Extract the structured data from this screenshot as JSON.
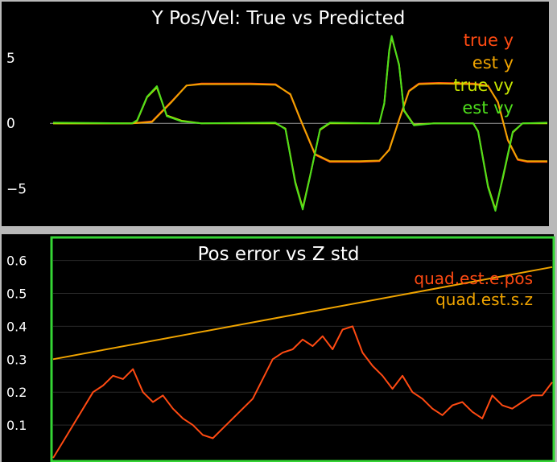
{
  "colors": {
    "true_y": "#ff4a12",
    "est_y": "#f0a400",
    "true_vy": "#c6e400",
    "est_vy": "#4ede1c",
    "pos_err": "#ff4a12",
    "std_z": "#f0a400",
    "axis_text": "#ffffff",
    "zero_line": "#9a9a9a",
    "grid": "#2a2a2a",
    "panel_bg": "#000000",
    "highlight_border": "#35d535",
    "window_bg": "#b9b9b9"
  },
  "chart_data": [
    {
      "type": "line",
      "title": "Y Pos/Vel: True vs Predicted",
      "xlabel": "",
      "ylabel": "",
      "ylim": [
        -7.2,
        7.6
      ],
      "xlim": [
        0,
        1
      ],
      "yticks": [
        5,
        0,
        -5
      ],
      "ytick_labels": [
        "5",
        "0",
        "−5"
      ],
      "legend": [
        "true y",
        "est y",
        "true vy",
        "est vy"
      ],
      "legend_placement": "top-right",
      "grid": false,
      "series": [
        {
          "name": "true y",
          "x": [
            0,
            0.07,
            0.16,
            0.2,
            0.24,
            0.27,
            0.3,
            0.4,
            0.45,
            0.48,
            0.5,
            0.53,
            0.56,
            0.62,
            0.66,
            0.68,
            0.7,
            0.72,
            0.74,
            0.78,
            0.85,
            0.88,
            0.9,
            0.92,
            0.94,
            0.96,
            1
          ],
          "values": [
            0,
            0,
            0,
            0.15,
            1.7,
            2.9,
            3.05,
            3.05,
            3.0,
            2.2,
            0.3,
            -2.4,
            -2.95,
            -2.95,
            -2.9,
            -2.0,
            0.3,
            2.5,
            3.05,
            3.1,
            3.05,
            2.9,
            1.6,
            -1.3,
            -2.8,
            -2.95,
            -2.95
          ]
        },
        {
          "name": "est y",
          "x": [
            0,
            0.07,
            0.16,
            0.2,
            0.24,
            0.27,
            0.3,
            0.4,
            0.45,
            0.48,
            0.5,
            0.53,
            0.56,
            0.62,
            0.66,
            0.68,
            0.7,
            0.72,
            0.74,
            0.78,
            0.85,
            0.88,
            0.9,
            0.92,
            0.94,
            0.96,
            1
          ],
          "values": [
            0,
            0,
            0,
            0.1,
            1.65,
            2.9,
            3.0,
            3.0,
            2.95,
            2.25,
            0.35,
            -2.35,
            -2.9,
            -2.9,
            -2.85,
            -2.05,
            0.25,
            2.45,
            3.0,
            3.05,
            3.0,
            2.85,
            1.65,
            -1.25,
            -2.75,
            -2.9,
            -2.9
          ]
        },
        {
          "name": "true vy",
          "x": [
            0,
            0.16,
            0.17,
            0.19,
            0.21,
            0.23,
            0.26,
            0.3,
            0.45,
            0.47,
            0.49,
            0.505,
            0.52,
            0.54,
            0.56,
            0.66,
            0.67,
            0.68,
            0.685,
            0.7,
            0.71,
            0.73,
            0.77,
            0.85,
            0.86,
            0.88,
            0.895,
            0.91,
            0.93,
            0.95,
            1
          ],
          "values": [
            0,
            0,
            0.2,
            2.0,
            2.75,
            0.6,
            0.2,
            0,
            0,
            -0.4,
            -4.5,
            -6.5,
            -4.0,
            -0.5,
            0,
            0,
            1.5,
            5.5,
            6.6,
            4.5,
            1.0,
            -0.1,
            0,
            0,
            -0.6,
            -4.8,
            -6.6,
            -4.2,
            -0.7,
            0,
            0
          ]
        },
        {
          "name": "est vy",
          "x": [
            0,
            0.16,
            0.17,
            0.19,
            0.21,
            0.23,
            0.26,
            0.3,
            0.45,
            0.47,
            0.49,
            0.505,
            0.52,
            0.54,
            0.56,
            0.66,
            0.67,
            0.68,
            0.685,
            0.7,
            0.71,
            0.73,
            0.77,
            0.85,
            0.86,
            0.88,
            0.895,
            0.91,
            0.93,
            0.95,
            1
          ],
          "values": [
            0.05,
            0,
            0.25,
            2.05,
            2.85,
            0.55,
            0.15,
            0,
            0.05,
            -0.45,
            -4.6,
            -6.6,
            -4.05,
            -0.45,
            0.05,
            0,
            1.55,
            5.6,
            6.7,
            4.45,
            0.95,
            -0.15,
            0,
            0,
            -0.65,
            -4.9,
            -6.7,
            -4.1,
            -0.65,
            0,
            0.05
          ]
        }
      ]
    },
    {
      "type": "line",
      "title": "Pos error vs Z std",
      "xlabel": "",
      "ylabel": "",
      "ylim": [
        0,
        0.67
      ],
      "xlim": [
        0,
        1
      ],
      "yticks": [
        0.6,
        0.5,
        0.4,
        0.3,
        0.2,
        0.1
      ],
      "ytick_labels": [
        "0.6",
        "0.5",
        "0.4",
        "0.3",
        "0.2",
        "0.1"
      ],
      "legend": [
        "quad.est.e.pos",
        "quad.est.s.z"
      ],
      "legend_placement": "top-right",
      "grid": true,
      "series": [
        {
          "name": "quad.est.e.pos",
          "x": [
            0,
            0.02,
            0.04,
            0.06,
            0.08,
            0.1,
            0.12,
            0.14,
            0.16,
            0.18,
            0.2,
            0.22,
            0.24,
            0.26,
            0.28,
            0.3,
            0.32,
            0.34,
            0.36,
            0.38,
            0.4,
            0.42,
            0.44,
            0.46,
            0.48,
            0.5,
            0.52,
            0.54,
            0.56,
            0.58,
            0.6,
            0.62,
            0.64,
            0.66,
            0.68,
            0.7,
            0.72,
            0.74,
            0.76,
            0.78,
            0.8,
            0.82,
            0.84,
            0.86,
            0.88,
            0.9,
            0.92,
            0.94,
            0.96,
            0.98,
            1
          ],
          "values": [
            0.0,
            0.05,
            0.1,
            0.15,
            0.2,
            0.22,
            0.25,
            0.24,
            0.27,
            0.2,
            0.17,
            0.19,
            0.15,
            0.12,
            0.1,
            0.07,
            0.06,
            0.09,
            0.12,
            0.15,
            0.18,
            0.24,
            0.3,
            0.32,
            0.33,
            0.36,
            0.34,
            0.37,
            0.33,
            0.39,
            0.4,
            0.32,
            0.28,
            0.25,
            0.21,
            0.25,
            0.2,
            0.18,
            0.15,
            0.13,
            0.16,
            0.17,
            0.14,
            0.12,
            0.19,
            0.16,
            0.15,
            0.17,
            0.19,
            0.19,
            0.23
          ]
        },
        {
          "name": "quad.est.s.z",
          "x": [
            0,
            1
          ],
          "values": [
            0.3,
            0.58
          ]
        }
      ]
    }
  ]
}
